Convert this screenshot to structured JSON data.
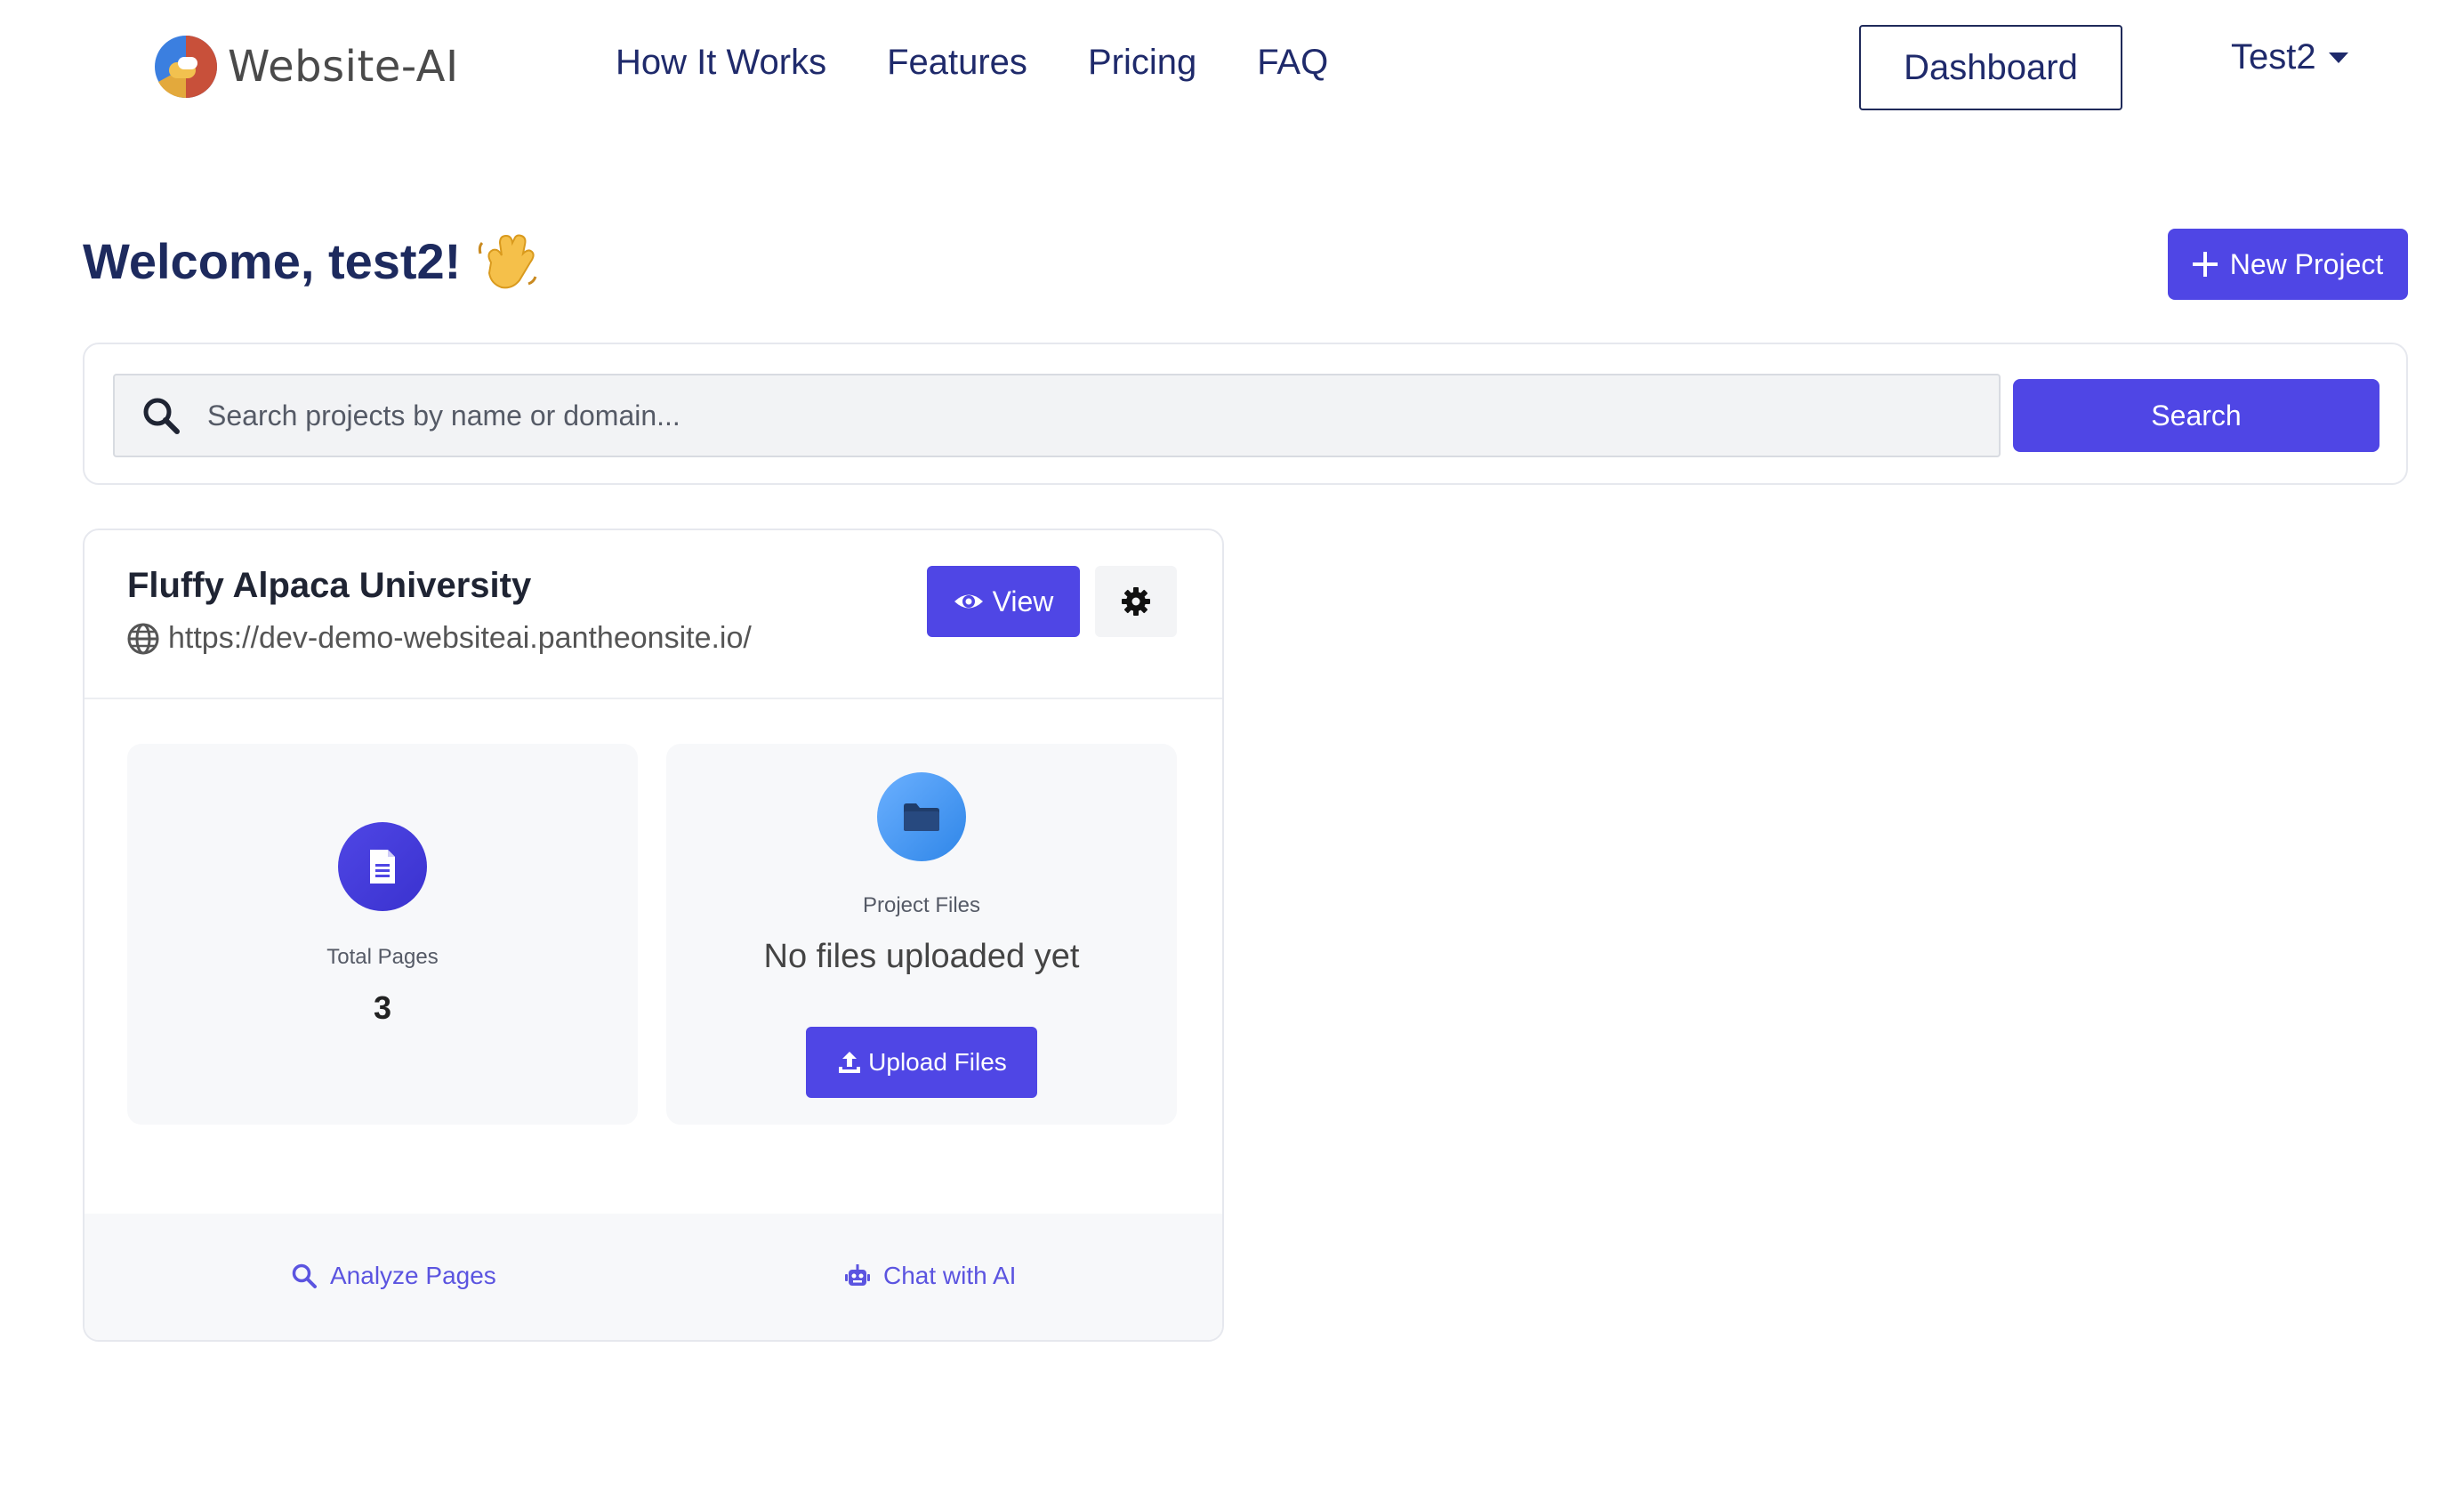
{
  "nav": {
    "brand": "Website-AI",
    "links": [
      "How It Works",
      "Features",
      "Pricing",
      "FAQ"
    ],
    "dashboard_label": "Dashboard",
    "user": "Test2"
  },
  "header": {
    "welcome": "Welcome, test2!",
    "new_project_label": "New Project"
  },
  "search": {
    "placeholder": "Search projects by name or domain...",
    "value": "",
    "button_label": "Search"
  },
  "project": {
    "name": "Fluffy Alpaca University",
    "url": "https://dev-demo-websiteai.pantheonsite.io/",
    "view_label": "View",
    "stats": {
      "pages_label": "Total Pages",
      "pages_value": "3",
      "files_label": "Project Files",
      "files_status": "No files uploaded yet",
      "upload_label": "Upload Files"
    },
    "footer": {
      "analyze_label": "Analyze Pages",
      "chat_label": "Chat with AI"
    }
  },
  "colors": {
    "accent": "#4f46e5",
    "navy": "#1f2a5a",
    "files_blue": "#2f86e8"
  },
  "icons": [
    "website-ai-logo",
    "waving-hand-icon",
    "plus-icon",
    "search-icon",
    "globe-icon",
    "eye-icon",
    "gear-icon",
    "file-icon",
    "folder-icon",
    "upload-icon",
    "robot-icon"
  ]
}
